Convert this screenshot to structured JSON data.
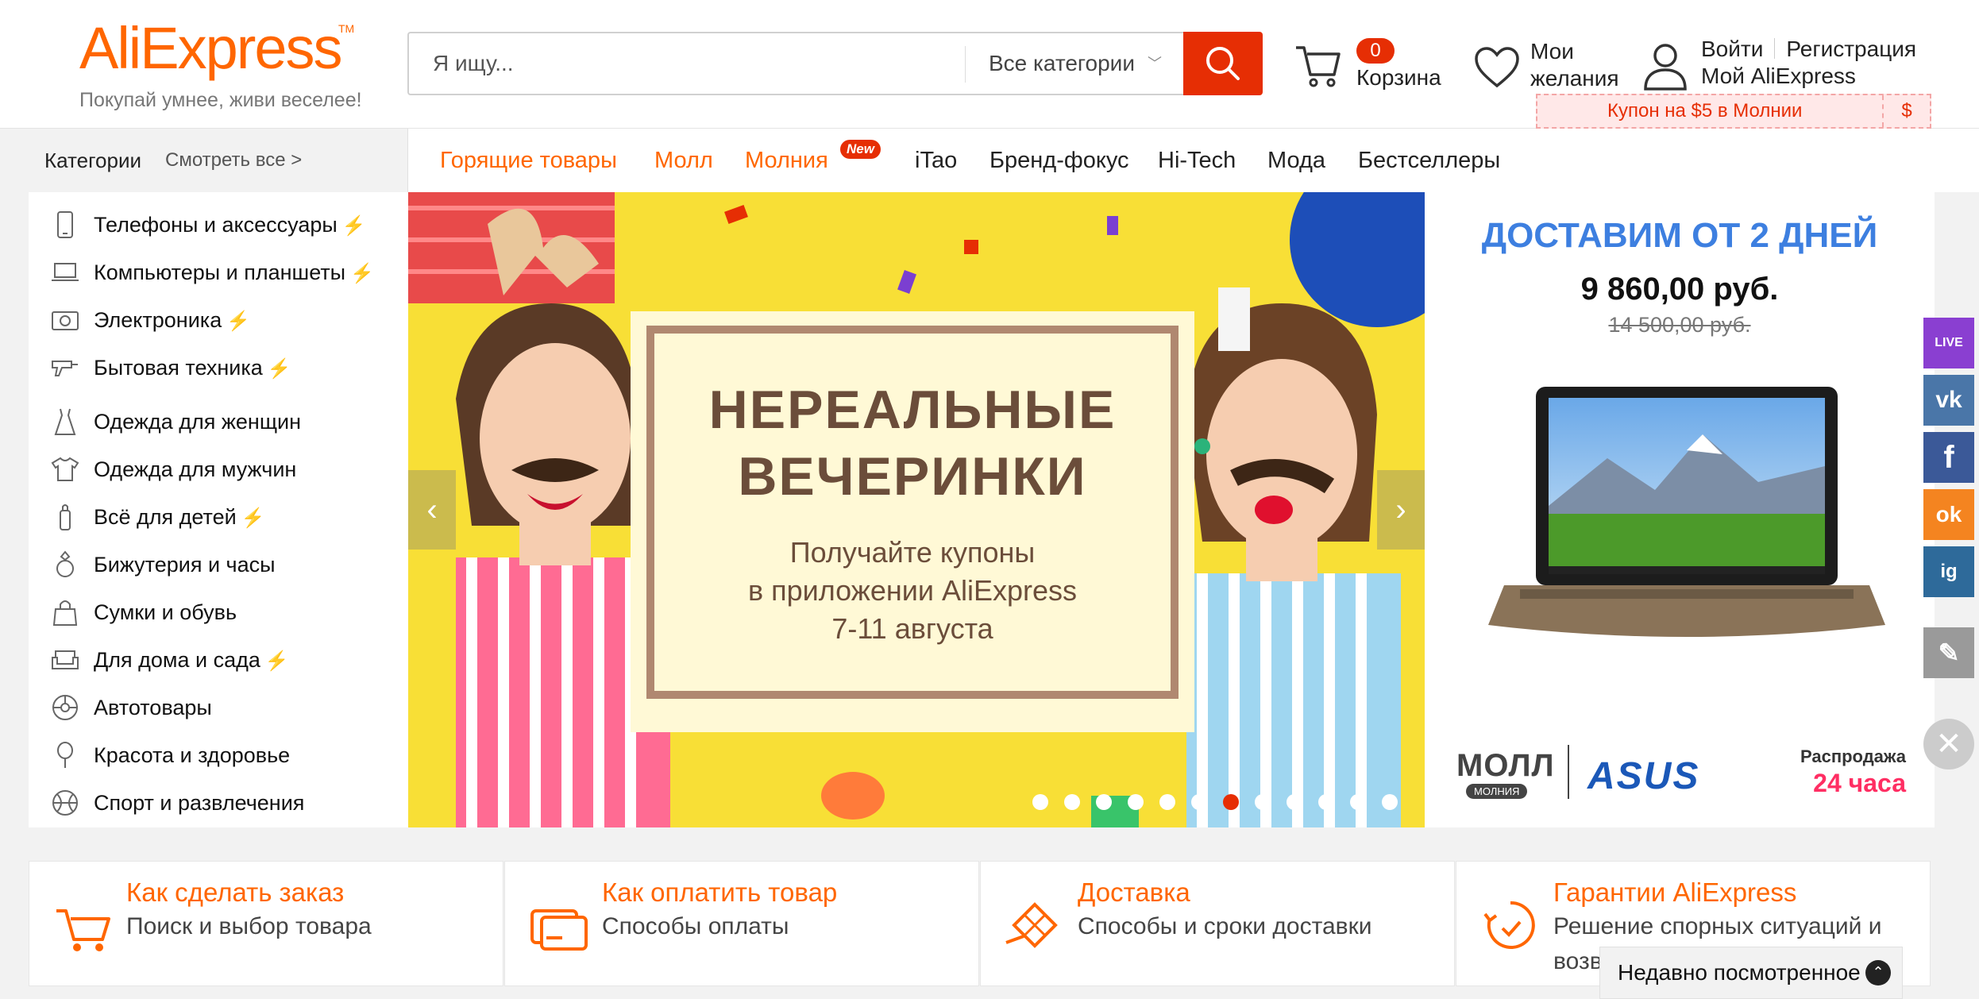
{
  "header": {
    "logo": "AliExpress",
    "logo_tm": "TM",
    "tagline": "Покупай умнее, живи веселее!",
    "search_placeholder": "Я ищу...",
    "search_category": "Все категории",
    "cart_count": "0",
    "cart_label": "Корзина",
    "wishlist_line1": "Мои",
    "wishlist_line2": "желания",
    "login": "Войти",
    "register": "Регистрация",
    "my_account": "Мой AliExpress",
    "coupon": "Купон на $5 в Молнии",
    "coupon_symbol": "$"
  },
  "categories_header": {
    "title": "Категории",
    "see_all": "Смотреть все >"
  },
  "nav": {
    "items": [
      "Горящие товары",
      "Молл",
      "Молния",
      "iTao",
      "Бренд-фокус",
      "Hi-Tech",
      "Мода",
      "Бестселлеры"
    ],
    "new_badge": "New"
  },
  "sidebar": {
    "items": [
      {
        "label": "Телефоны и аксессуары",
        "icon": "phone-icon",
        "bolt": "⚡"
      },
      {
        "label": "Компьютеры и планшеты",
        "icon": "laptop-icon",
        "bolt": "⚡"
      },
      {
        "label": "Электроника",
        "icon": "camera-icon",
        "bolt": "⚡"
      },
      {
        "label": "Бытовая техника",
        "icon": "drill-icon",
        "bolt": "⚡"
      },
      {
        "label": "Одежда для женщин",
        "icon": "dress-icon",
        "bolt": ""
      },
      {
        "label": "Одежда для мужчин",
        "icon": "shirt-icon",
        "bolt": ""
      },
      {
        "label": "Всё для детей",
        "icon": "baby-bottle-icon",
        "bolt": "⚡"
      },
      {
        "label": "Бижутерия и часы",
        "icon": "ring-icon",
        "bolt": ""
      },
      {
        "label": "Сумки и обувь",
        "icon": "bag-icon",
        "bolt": ""
      },
      {
        "label": "Для дома и сада",
        "icon": "sofa-icon",
        "bolt": "⚡"
      },
      {
        "label": "Автотовары",
        "icon": "wheel-icon",
        "bolt": ""
      },
      {
        "label": "Красота и здоровье",
        "icon": "mirror-icon",
        "bolt": ""
      },
      {
        "label": "Спорт и развлечения",
        "icon": "ball-icon",
        "bolt": ""
      }
    ]
  },
  "banner": {
    "title_line1": "НЕРЕАЛЬНЫЕ",
    "title_line2": "ВЕЧЕРИНКИ",
    "sub_line1": "Получайте купоны",
    "sub_line2": "в приложении AliExpress",
    "sub_line3": "7-11 августа",
    "slide_count": 12,
    "active_slide": 6,
    "prev": "‹",
    "next": "›"
  },
  "promo": {
    "title": "ДОСТАВИМ ОТ 2 ДНЕЙ",
    "price": "9 860,00 руб.",
    "old_price": "14 500,00 руб.",
    "mall": "МОЛЛ",
    "mall_sub": "МОЛНИЯ",
    "brand": "ASUS",
    "laptop_brand": "ASUS",
    "sale_label": "Распродажа",
    "sale_time": "24 часа"
  },
  "social": {
    "live": "LIVE",
    "vk": "vk",
    "facebook": "f",
    "ok": "ok",
    "instagram": "ig",
    "feedback": "✎",
    "close": "✕",
    "colors": {
      "live": "#8a3fd1",
      "vk": "#4a76a8",
      "facebook": "#3b5998",
      "ok": "#f48420",
      "instagram": "#2e6a9a",
      "feedback": "#9a9a9a"
    }
  },
  "info": [
    {
      "title": "Как сделать заказ",
      "sub": "Поиск и выбор товара",
      "icon": "cart-icon"
    },
    {
      "title": "Как оплатить товар",
      "sub": "Способы оплаты",
      "icon": "credit-card-icon"
    },
    {
      "title": "Доставка",
      "sub": "Способы и сроки доставки",
      "icon": "delivery-icon"
    },
    {
      "title": "Гарантии AliExpress",
      "sub": "Решение спорных ситуаций и возв",
      "icon": "guarantee-icon"
    }
  ],
  "recent": {
    "label": "Недавно посмотренное",
    "icon": "⌃"
  },
  "colors": {
    "accent": "#ff6600",
    "search_button": "#e62e04",
    "badge": "#e62e04",
    "promo_title": "#3d7fe0",
    "sale_time": "#ff2e63",
    "bolt": "#ffb400"
  }
}
